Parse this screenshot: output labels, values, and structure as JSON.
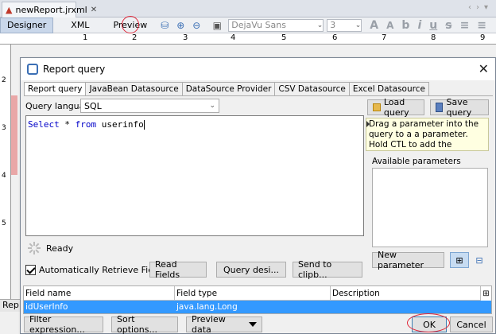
{
  "editor": {
    "file_tab": "newReport.jrxml",
    "view_tabs": [
      "Designer",
      "XML",
      "Preview"
    ],
    "font_name": "DejaVu Sans",
    "font_size": "3",
    "ruler_numbers": [
      "1",
      "2",
      "3",
      "4",
      "5",
      "6",
      "7",
      "8",
      "9"
    ],
    "vruler_numbers": [
      "2",
      "3",
      "4",
      "5"
    ],
    "bottom_strip": "Rep"
  },
  "dialog": {
    "title": "Report query",
    "tabs": [
      "Report query",
      "JavaBean Datasource",
      "DataSource Provider",
      "CSV Datasource",
      "Excel Datasource"
    ],
    "query_language_label": "Query language",
    "query_language_value": "SQL",
    "query": {
      "kw1": "Select",
      "mid": " * ",
      "kw2": "from",
      "rest": " userinfo"
    },
    "status": "Ready",
    "auto_retrieve_label": "Automatically Retrieve Fields",
    "read_fields": "Read Fields",
    "query_designer": "Query desi...",
    "send_clipboard": "Send to clipb...",
    "load_query": "Load query",
    "save_query": "Save query",
    "hint_text": "Drag a parameter into the query to a a parameter. Hold CTL to add the parameter as query chunk.",
    "available_parameters": "Available parameters",
    "new_parameter": "New parameter",
    "fields_table": {
      "headers": [
        "Field name",
        "Field type",
        "Description"
      ],
      "rows": [
        {
          "name": "idUserInfo",
          "type": "java.lang.Long",
          "description": ""
        }
      ]
    },
    "filter_expression": "Filter expression...",
    "sort_options": "Sort options...",
    "preview_data": "Preview data",
    "ok": "OK",
    "cancel": "Cancel"
  },
  "colors": {
    "selection": "#3399ff",
    "keyword": "#0000c8",
    "annotation": "#e0283a"
  }
}
